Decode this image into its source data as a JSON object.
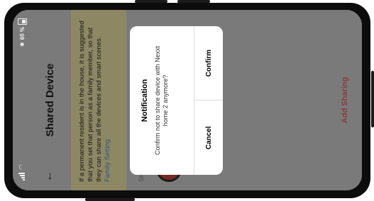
{
  "status_bar": {
    "battery_percent": "60 %",
    "bluetooth_icon": "bluetooth-icon",
    "wifi_icon": "wifi-icon",
    "signal_icon": "signal-icon",
    "battery_icon": "battery-icon"
  },
  "header": {
    "back_icon": "back-arrow-icon",
    "title": "Shared Device"
  },
  "tip": {
    "text": "If a permanent resident is in the house, it is suggested that you set that person as a family member, so that they can share all the devices and smart scenes.",
    "link_text": "Family Setting"
  },
  "sharing_list": {
    "label": "Sharing List"
  },
  "add_sharing": {
    "label": "Add Sharing"
  },
  "dialog": {
    "title": "Notification",
    "message": "Confirm not to share device with Nexxt home 2 anymore?",
    "cancel_label": "Cancel",
    "confirm_label": "Confirm"
  },
  "colors": {
    "overlay_background": "#7a7a7a",
    "tip_background": "#8d8764",
    "link": "#2d5c79",
    "accent": "#8a3c3c",
    "dialog_background": "#ffffff"
  }
}
